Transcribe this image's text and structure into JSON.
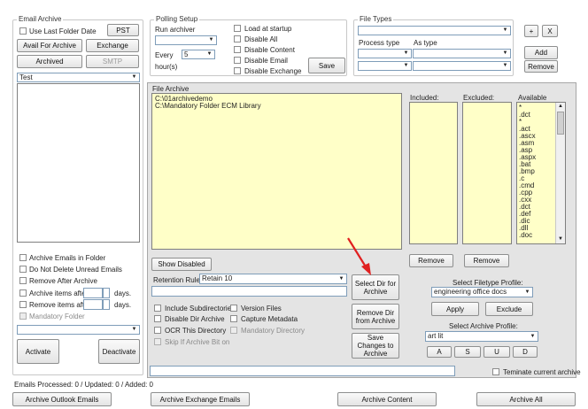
{
  "email_archive": {
    "title": "Email Archive",
    "use_last_folder_date": "Use Last Folder Date",
    "pst_label": "PST",
    "avail_for_archive_label": "Avail For Archive",
    "exchange_label": "Exchange",
    "archived_label": "Archived",
    "smtp_label": "SMTP",
    "mailbox_value": "Test",
    "archive_emails_in_folder": "Archive Emails in Folder",
    "do_not_delete_unread": "Do Not Delete Unread Emails",
    "remove_after_archive": "Remove After Archive",
    "archive_items_after": "Archive items after",
    "remove_items_after": "Remove items after",
    "days": "days.",
    "mandatory_folder": "Mandatory Folder",
    "activate_label": "Activate",
    "deactivate_label": "Deactivate"
  },
  "polling": {
    "title": "Polling Setup",
    "run_archiver": "Run archiver",
    "every": "Every",
    "every_value": "5",
    "hours": "hour(s)",
    "load_at_startup": "Load at startup",
    "disable_all": "Disable All",
    "disable_content": "Disable Content",
    "disable_email": "Disable Email",
    "disable_exchange": "Disable Exchange",
    "save_label": "Save"
  },
  "file_types": {
    "title": "File Types",
    "process_type": "Process type",
    "as_type": "As type",
    "plus_label": "+",
    "x_label": "X",
    "add_label": "Add",
    "remove_label": "Remove"
  },
  "file_archive": {
    "title": "File Archive",
    "directories": [
      "C:\\01archivedemo",
      "C:\\Mandatory Folder ECM Library"
    ],
    "show_disabled_label": "Show Disabled",
    "retention_rule_label": "Retention Rule:",
    "retention_rule_value": "Retain 10",
    "include_subdirectories": "Include Subdirectories",
    "version_files": "Version Files",
    "disable_dir_archive": "Disable Dir Archive",
    "capture_metadata": "Capture Metadata",
    "ocr_this_directory": "OCR This Directory",
    "mandatory_directory": "Mandatory Directory",
    "skip_if_archive_bit": "Skip If Archive Bit on",
    "select_dir_label": "Select Dir for Archive",
    "remove_dir_label": "Remove Dir from Archive",
    "save_changes_label": "Save Changes to Archive",
    "included_label": "Included:",
    "excluded_label": "Excluded:",
    "available_label": "Available",
    "available_items": [
      "*",
      ".dct",
      "*",
      ".act",
      ".ascx",
      ".asm",
      ".asp",
      ".aspx",
      ".bat",
      ".bmp",
      ".c",
      ".cmd",
      ".cpp",
      ".cxx",
      ".dct",
      ".def",
      ".dic",
      ".dll",
      ".doc"
    ],
    "remove_included_label": "Remove",
    "remove_excluded_label": "Remove",
    "select_filetype_profile_label": "Select Filetype Profile:",
    "filetype_profile_value": "engineering office docs",
    "apply_label": "Apply",
    "exclude_label": "Exclude",
    "select_archive_profile_label": "Select Archive Profile:",
    "archive_profile_value": "art lit",
    "a_label": "A",
    "s_label": "S",
    "u_label": "U",
    "d_label": "D",
    "terminate_label": "Teminate current archive"
  },
  "status": {
    "text": "Emails Processed: 0  /  Updated: 0  /  Added: 0"
  },
  "bottom_buttons": {
    "archive_outlook": "Archive Outlook Emails",
    "archive_exchange": "Archive Exchange Emails",
    "archive_content": "Archive Content",
    "archive_all": "Archive All"
  },
  "colors": {
    "list_yellow": "#ffffc8",
    "panel_gray": "#e4e4e4",
    "annotation_arrow": "#e02020"
  }
}
